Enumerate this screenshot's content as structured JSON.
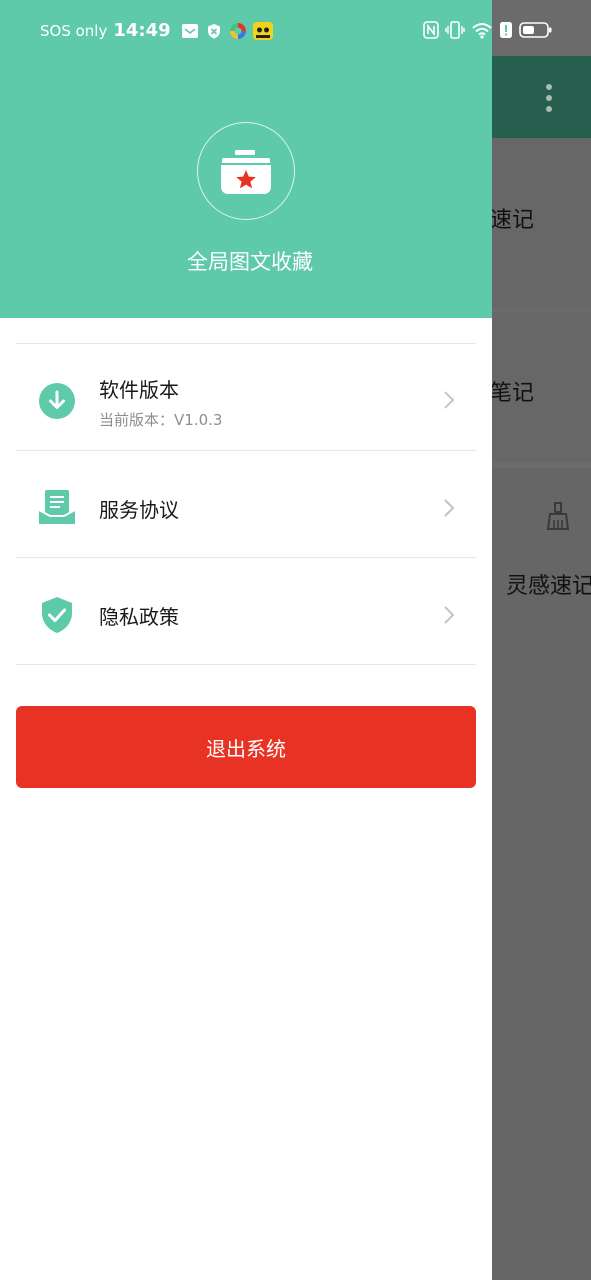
{
  "status_bar": {
    "carrier": "SOS only",
    "time": "14:49"
  },
  "background": {
    "card1_text": "速记",
    "card2_text": "笔记",
    "card3_text": "灵感速记"
  },
  "drawer": {
    "app_name": "全局图文收藏",
    "menu": [
      {
        "title": "软件版本",
        "subtitle": "当前版本：V1.0.3",
        "icon": "download-icon"
      },
      {
        "title": "服务协议",
        "icon": "agreement-icon"
      },
      {
        "title": "隐私政策",
        "icon": "shield-check-icon"
      }
    ],
    "logout_label": "退出系统"
  },
  "colors": {
    "header_green": "#5fcaa9",
    "accent_green": "#5fcaa9",
    "logout_red": "#e83223"
  }
}
